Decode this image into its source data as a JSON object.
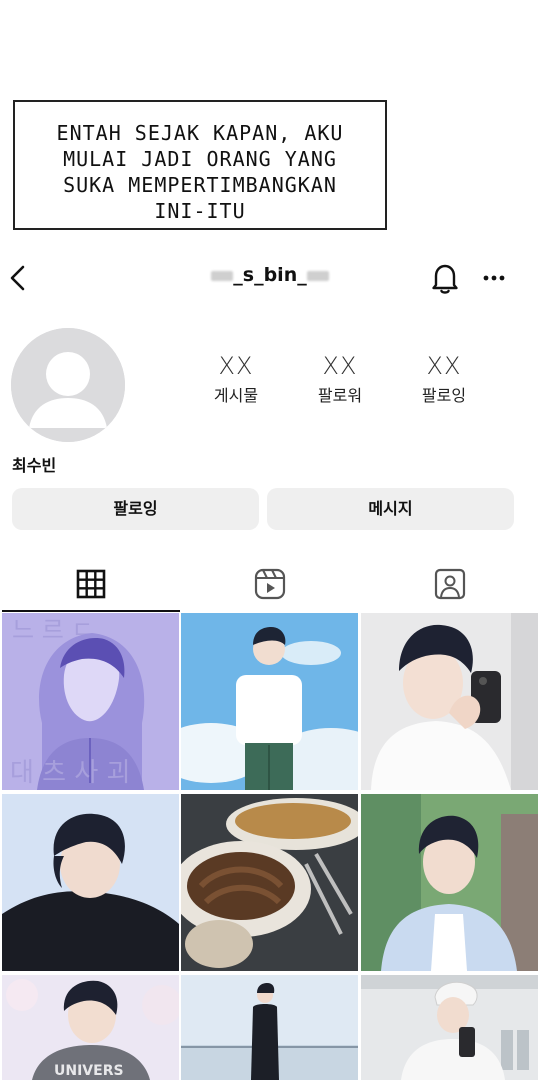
{
  "caption": {
    "lines": [
      "ENTAH SEJAK KAPAN, AKU",
      "MULAI JADI ORANG YANG",
      "SUKA MEMPERTIMBANGKAN",
      "INI-ITU"
    ]
  },
  "header": {
    "username_core": "_s_bin_",
    "back_icon": "chevron-left-icon",
    "bell_icon": "bell-icon",
    "more_icon": "more-horizontal-icon"
  },
  "profile": {
    "display_name": "최수빈",
    "stats": [
      {
        "value": "XX",
        "label": "게시물"
      },
      {
        "value": "XX",
        "label": "팔로워"
      },
      {
        "value": "XX",
        "label": "팔로잉"
      }
    ]
  },
  "actions": {
    "follow_label": "팔로잉",
    "message_label": "메시지"
  },
  "tabs": [
    {
      "name": "grid",
      "icon": "grid-icon",
      "active": true
    },
    {
      "name": "reels",
      "icon": "reels-icon",
      "active": false
    },
    {
      "name": "tagged",
      "icon": "tagged-icon",
      "active": false
    }
  ],
  "posts": [
    {
      "description": "purple hoodie drawing"
    },
    {
      "description": "boy in white tee under blue sky"
    },
    {
      "description": "selfie with phone"
    },
    {
      "description": "boy in black sweater"
    },
    {
      "description": "croissant and bread"
    },
    {
      "description": "boy in blue shirt outdoors"
    },
    {
      "description": "boy with UNIVERSE sweatshirt"
    },
    {
      "description": "boy in black on balcony"
    },
    {
      "description": "boy with cap mirror selfie"
    }
  ]
}
